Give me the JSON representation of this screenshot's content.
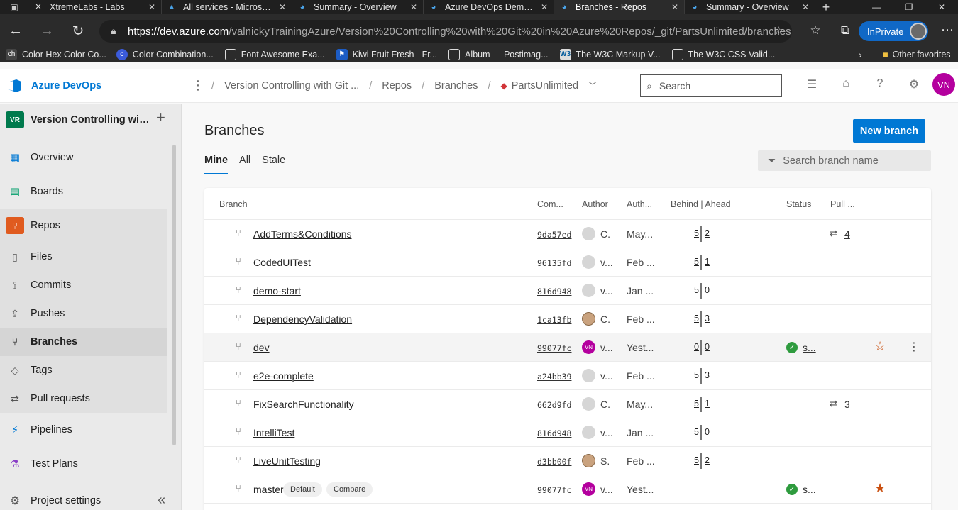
{
  "browser": {
    "tabs": [
      {
        "title": "XtremeLabs - Labs",
        "icon": "page-icon"
      },
      {
        "title": "All services - Microsoft Azure",
        "icon": "azure-icon"
      },
      {
        "title": "Summary - Overview",
        "icon": "devops-icon"
      },
      {
        "title": "Azure DevOps Demo Generator",
        "icon": "devops-icon"
      },
      {
        "title": "Branches - Repos",
        "icon": "devops-icon"
      },
      {
        "title": "Summary - Overview",
        "icon": "devops-icon"
      }
    ],
    "active_tab": 4,
    "url_host": "https://dev.azure.com",
    "url_path": "/valnickyTrainingAzure/Version%20Controlling%20with%20Git%20in%20Azure%20Repos/_git/PartsUnlimited/branches",
    "inprivate_label": "InPrivate",
    "bookmarks": [
      {
        "label": "Color Hex Color Co...",
        "icon": "colorhex-icon"
      },
      {
        "label": "Color Combination...",
        "icon": "c-icon"
      },
      {
        "label": "Font Awesome Exa...",
        "icon": "page-icon"
      },
      {
        "label": "Kiwi Fruit Fresh - Fr...",
        "icon": "flag-icon"
      },
      {
        "label": "Album — Postimag...",
        "icon": "px-icon"
      },
      {
        "label": "The W3C Markup V...",
        "icon": "page-icon"
      },
      {
        "label": "The W3C CSS Valid...",
        "icon": "w3c-icon"
      }
    ],
    "other_favorites": "Other favorites"
  },
  "header": {
    "product": "Azure DevOps",
    "breadcrumbs": [
      "Version Controlling with Git ...",
      "Repos",
      "Branches"
    ],
    "repo": "PartsUnlimited",
    "search_placeholder": "Search",
    "user_initials": "VN"
  },
  "sidebar": {
    "project_initials": "VR",
    "project_name": "Version Controlling with Git in Azure Repos",
    "items": [
      {
        "label": "Overview",
        "icon": "overview-icon"
      },
      {
        "label": "Boards",
        "icon": "boards-icon"
      },
      {
        "label": "Repos",
        "icon": "repos-icon"
      },
      {
        "label": "Files",
        "icon": "files-icon"
      },
      {
        "label": "Commits",
        "icon": "commits-icon"
      },
      {
        "label": "Pushes",
        "icon": "pushes-icon"
      },
      {
        "label": "Branches",
        "icon": "branches-icon"
      },
      {
        "label": "Tags",
        "icon": "tags-icon"
      },
      {
        "label": "Pull requests",
        "icon": "pull-requests-icon"
      },
      {
        "label": "Pipelines",
        "icon": "pipelines-icon"
      },
      {
        "label": "Test Plans",
        "icon": "test-plans-icon"
      }
    ],
    "project_settings": "Project settings"
  },
  "main": {
    "title": "Branches",
    "new_branch_label": "New branch",
    "pivots": [
      "Mine",
      "All",
      "Stale"
    ],
    "active_pivot": "Mine",
    "filter_placeholder": "Search branch name",
    "columns": [
      "Branch",
      "Com...",
      "Author",
      "Auth...",
      "Behind | Ahead",
      "Status",
      "Pull ..."
    ],
    "rows": [
      {
        "name": "AddTerms&Conditions",
        "commit": "9da57ed",
        "author": "C.",
        "date": "May...",
        "behind": "5",
        "ahead": "2",
        "pr": "4",
        "avatar": "default"
      },
      {
        "name": "CodedUITest",
        "commit": "96135fd",
        "author": "v...",
        "date": "Feb ...",
        "behind": "5",
        "ahead": "1",
        "avatar": "default"
      },
      {
        "name": "demo-start",
        "commit": "816d948",
        "author": "v...",
        "date": "Jan ...",
        "behind": "5",
        "ahead": "0",
        "avatar": "default"
      },
      {
        "name": "DependencyValidation",
        "commit": "1ca13fb",
        "author": "C.",
        "date": "Feb ...",
        "behind": "5",
        "ahead": "3",
        "avatar": "photo"
      },
      {
        "name": "dev",
        "commit": "99077fc",
        "author": "v...",
        "date": "Yest...",
        "behind": "0",
        "ahead": "0",
        "status": "s...",
        "star": "empty",
        "avatar": "vn"
      },
      {
        "name": "e2e-complete",
        "commit": "a24bb39",
        "author": "v...",
        "date": "Feb ...",
        "behind": "5",
        "ahead": "3",
        "avatar": "default"
      },
      {
        "name": "FixSearchFunctionality",
        "commit": "662d9fd",
        "author": "C.",
        "date": "May...",
        "behind": "5",
        "ahead": "1",
        "pr": "3",
        "avatar": "default"
      },
      {
        "name": "IntelliTest",
        "commit": "816d948",
        "author": "v...",
        "date": "Jan ...",
        "behind": "5",
        "ahead": "0",
        "avatar": "default"
      },
      {
        "name": "LiveUnitTesting",
        "commit": "d3bb00f",
        "author": "S.",
        "date": "Feb ...",
        "behind": "5",
        "ahead": "2",
        "avatar": "photo"
      },
      {
        "name": "master",
        "commit": "99077fc",
        "author": "v...",
        "date": "Yest...",
        "badges": [
          "Default",
          "Compare"
        ],
        "status": "s...",
        "star": "filled",
        "avatar": "vn"
      }
    ],
    "avatar_initials": "VN"
  }
}
